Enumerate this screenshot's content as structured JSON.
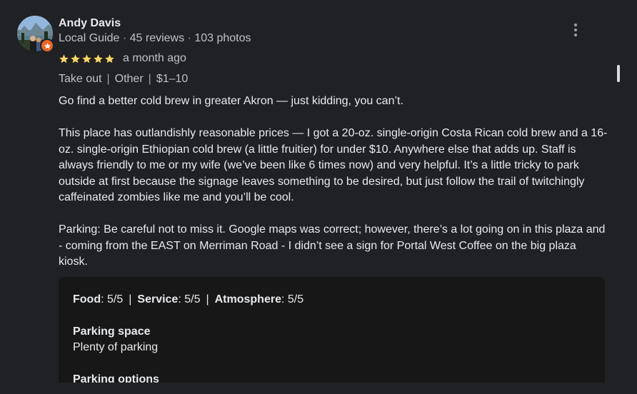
{
  "reviewer": {
    "name": "Andy Davis",
    "role": "Local Guide",
    "sep": "·",
    "reviews": "45 reviews",
    "photos": "103 photos"
  },
  "review": {
    "rating": 5,
    "rating_max": 5,
    "time": "a month ago",
    "tags": [
      "Take out",
      "Other",
      "$1–10"
    ],
    "tag_separator": "|",
    "paragraphs": [
      "Go find a better cold brew in greater Akron — just kidding, you can’t.",
      "This place has outlandishly reasonable prices — I got a 20-oz. single-origin Costa Rican cold brew and a 16-oz. single-origin Ethiopian cold brew (a little fruitier) for under $10. Anywhere else that adds up. Staff is always friendly to me or my wife (we’ve been like 6 times now) and very helpful. It’s a little tricky to park outside at first because the signage leaves something to be desired, but just follow the trail of twitchingly caffeinated zombies like me and you’ll be cool.",
      "Parking: Be careful not to miss it. Google maps was correct; however, there’s a lot going on in this plaza and - coming from the EAST on Merriman Road - I didn’t see a sign for Portal West Coffee on the big plaza kiosk."
    ]
  },
  "ratings": {
    "items": [
      {
        "label": "Food",
        "score": ": 5/5"
      },
      {
        "label": "Service",
        "score": ": 5/5"
      },
      {
        "label": "Atmosphere",
        "score": ": 5/5"
      }
    ],
    "separator": "|"
  },
  "attributes": [
    {
      "title": "Parking space",
      "value": "Plenty of parking"
    },
    {
      "title": "Parking options",
      "value": ""
    }
  ],
  "icons": {
    "more": "more-vert-icon",
    "guide_badge": "local-guide-star-icon",
    "star": "star-icon"
  },
  "colors": {
    "background": "#202124",
    "star": "#fdd663",
    "guide_badge": "#f06423",
    "ratings_box": "#171717"
  }
}
